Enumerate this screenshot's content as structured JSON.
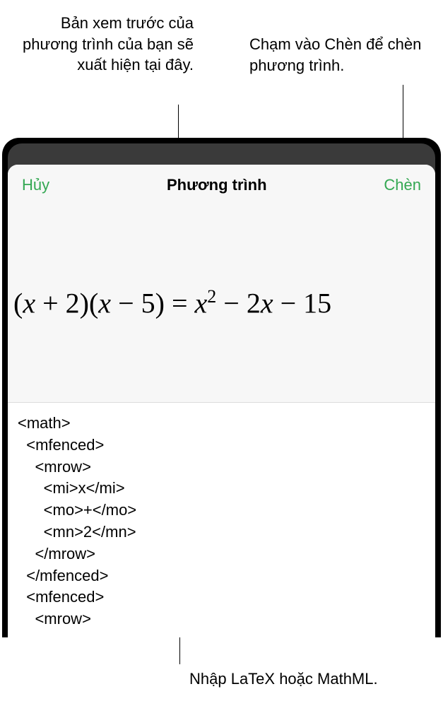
{
  "annotations": {
    "preview": "Bản xem trước của phương trình của bạn sẽ xuất hiện tại đây.",
    "insert": "Chạm vào Chèn để chèn phương trình.",
    "input": "Nhập LaTeX hoặc MathML."
  },
  "sheet": {
    "cancel_label": "Hủy",
    "title": "Phương trình",
    "insert_label": "Chèn"
  },
  "equation": {
    "code": "<math>\n  <mfenced>\n    <mrow>\n      <mi>x</mi>\n      <mo>+</mo>\n      <mn>2</mn>\n    </mrow>\n  </mfenced>\n  <mfenced>\n    <mrow>"
  },
  "colors": {
    "accent": "#34a853"
  }
}
